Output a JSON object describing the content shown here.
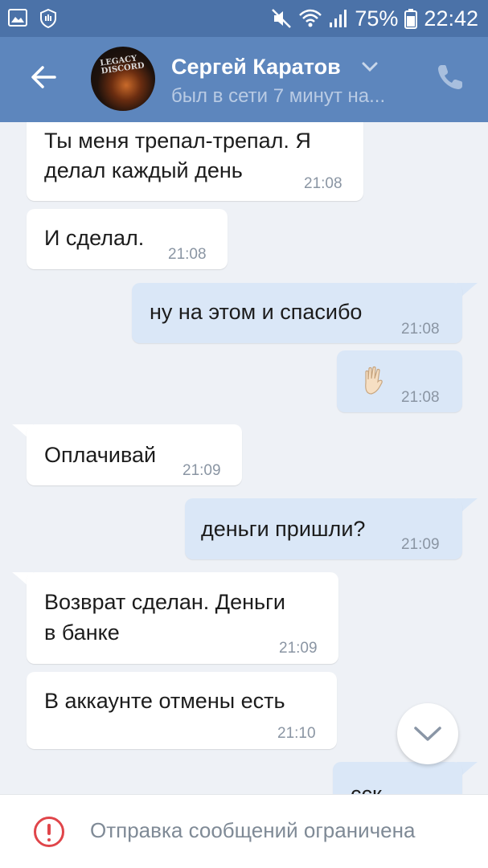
{
  "status_bar": {
    "battery": "75%",
    "time": "22:42"
  },
  "header": {
    "name": "Сергей Каратов",
    "subtitle": "был в сети 7 минут на...",
    "avatar_logo": "LEGACY DISCORD"
  },
  "messages": [
    {
      "direction": "in",
      "lines": [
        "Ты меня трепал-трепал.  Я",
        "делал каждый день"
      ],
      "time": "21:08"
    },
    {
      "direction": "in",
      "lines": [
        "И сделал."
      ],
      "time": "21:08"
    },
    {
      "direction": "out",
      "lines": [
        "ну на этом и спасибо"
      ],
      "time": "21:08"
    },
    {
      "direction": "out",
      "lines": [
        "✋"
      ],
      "time": "21:08"
    },
    {
      "direction": "in",
      "lines": [
        "Оплачивай"
      ],
      "time": "21:09"
    },
    {
      "direction": "out",
      "lines": [
        "деньги пришли?"
      ],
      "time": "21:09"
    },
    {
      "direction": "in",
      "lines": [
        "Возврат сделан. Деньги",
        "в банке"
      ],
      "time": "21:09"
    },
    {
      "direction": "in",
      "lines": [
        "В аккаунте отмены есть"
      ],
      "time": "21:10"
    },
    {
      "direction": "out",
      "lines": [
        "сск"
      ],
      "time": ""
    }
  ],
  "footer": {
    "notice": "Отправка сообщений ограничена"
  },
  "colors": {
    "header": "#5d86bd",
    "status_bar": "#4b72a8",
    "incoming": "#ffffff",
    "outgoing": "#dae7f7",
    "warning": "#e0454a"
  }
}
